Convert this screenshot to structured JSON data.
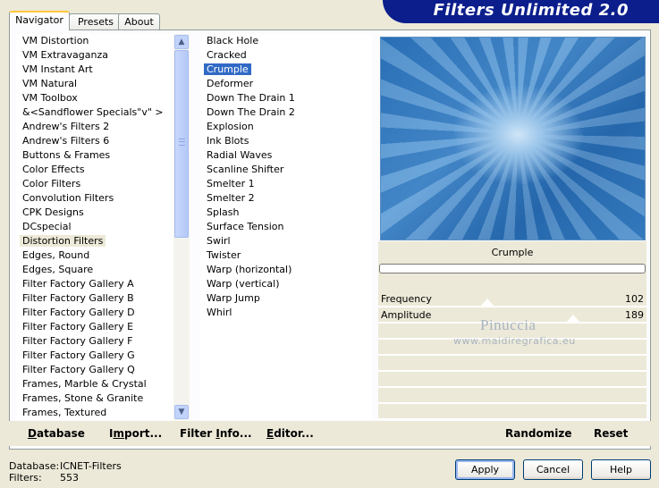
{
  "tabs": [
    {
      "label": "Navigator",
      "active": true
    },
    {
      "label": "Presets",
      "active": false
    },
    {
      "label": "About",
      "active": false
    }
  ],
  "banner_title": "Filters Unlimited 2.0",
  "categories": {
    "items": [
      "VM Distortion",
      "VM Extravaganza",
      "VM Instant Art",
      "VM Natural",
      "VM Toolbox",
      "&<Sandflower Specials\"v\" >",
      "Andrew's Filters 2",
      "Andrew's Filters 6",
      "Buttons & Frames",
      "Color Effects",
      "Color Filters",
      "Convolution Filters",
      "CPK Designs",
      "DCspecial",
      "Distortion Filters",
      "Edges, Round",
      "Edges, Square",
      "Filter Factory Gallery A",
      "Filter Factory Gallery B",
      "Filter Factory Gallery D",
      "Filter Factory Gallery E",
      "Filter Factory Gallery F",
      "Filter Factory Gallery G",
      "Filter Factory Gallery Q",
      "Frames, Marble & Crystal",
      "Frames, Stone & Granite",
      "Frames, Textured"
    ],
    "selected": "Distortion Filters"
  },
  "filters": {
    "items": [
      "Black Hole",
      "Cracked",
      "Crumple",
      "Deformer",
      "Down The Drain 1",
      "Down The Drain 2",
      "Explosion",
      "Ink Blots",
      "Radial Waves",
      "Scanline Shifter",
      "Smelter 1",
      "Smelter 2",
      "Splash",
      "Surface Tension",
      "Swirl",
      "Twister",
      "Warp (horizontal)",
      "Warp (vertical)",
      "Warp Jump",
      "Whirl"
    ],
    "selected": "Crumple"
  },
  "preview": {
    "filter_name": "Crumple",
    "sliders": [
      {
        "label": "Frequency",
        "value": "102",
        "level": 0.4
      },
      {
        "label": "Amplitude",
        "value": "189",
        "level": 0.74
      }
    ]
  },
  "watermark": {
    "line1": "Pinuccia",
    "line2": "www.maidiregrafica.eu"
  },
  "toolbar": {
    "database": {
      "accel": "D",
      "rest": "atabase"
    },
    "import": {
      "pre": "I",
      "accel": "m",
      "rest": "port..."
    },
    "filter_info": {
      "pre": "Filter ",
      "accel": "I",
      "rest": "nfo..."
    },
    "editor": {
      "accel": "E",
      "rest": "ditor..."
    },
    "randomize": "Randomize",
    "reset": "Reset"
  },
  "status": {
    "database_label": "Database:",
    "database_value": "ICNET-Filters",
    "filters_label": "Filters:",
    "filters_value": "553"
  },
  "buttons": {
    "apply": "Apply",
    "cancel": "Cancel",
    "help": "Help"
  },
  "colors": {
    "banner": "#0b1e8c",
    "selection": "#316ac5",
    "tab_accent": "#ffc83c"
  }
}
